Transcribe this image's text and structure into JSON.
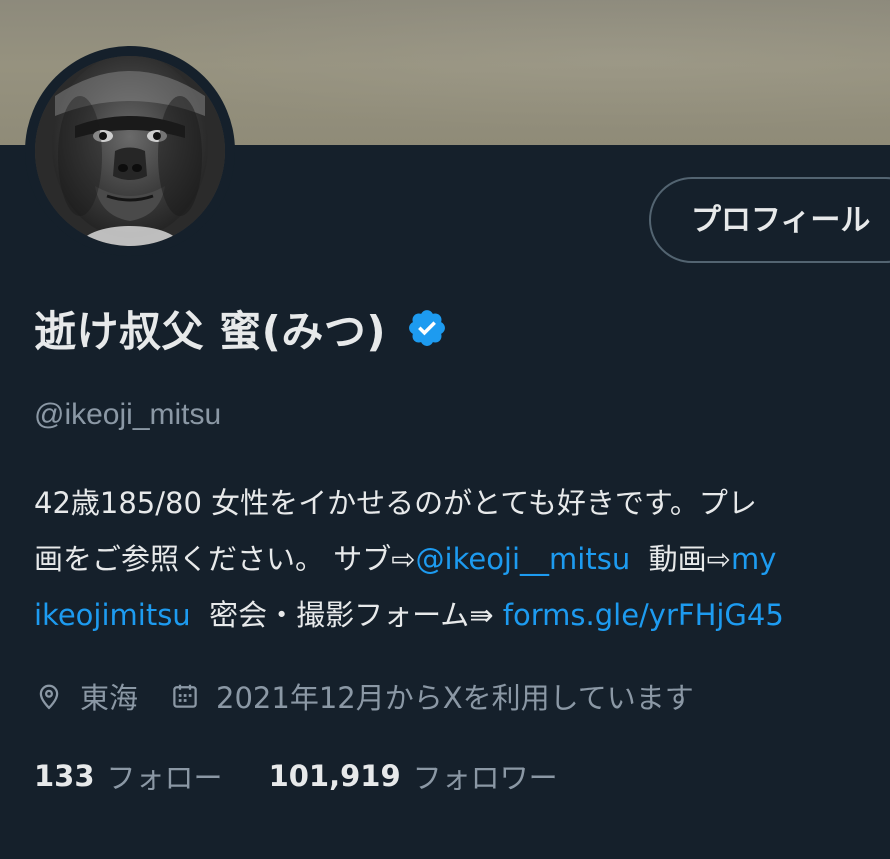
{
  "banner": {
    "color": "#918d7b"
  },
  "header": {
    "profile_button_label": "プロフィール"
  },
  "user": {
    "display_name": "逝け叔父 蜜(みつ)",
    "handle": "@ikeoji_mitsu",
    "verified": true
  },
  "bio": {
    "line1": "42歳185/80 女性をイかせるのがとても好きです。プレ",
    "line2_prefix": "画をご参照ください。 サブ⇨",
    "line2_link1": "@ikeoji__mitsu",
    "line2_mid": "  動画⇨",
    "line2_link2": "my",
    "line3_link1": "ikeojimitsu",
    "line3_mid": "  密会・撮影フォーム⇛ ",
    "line3_link2": "forms.gle/yrFHjG45"
  },
  "meta": {
    "location_icon": "location-pin-icon",
    "location": "東海",
    "calendar_icon": "calendar-icon",
    "joined": "2021年12月からXを利用しています"
  },
  "stats": {
    "following_count": "133",
    "following_label": "フォロー",
    "followers_count": "101,919",
    "followers_label": "フォロワー"
  },
  "colors": {
    "background": "#15202b",
    "text": "#e7e9ea",
    "muted": "#8b98a5",
    "link": "#1d9bf0",
    "verified": "#1d9bf0",
    "button_border": "#536471"
  }
}
